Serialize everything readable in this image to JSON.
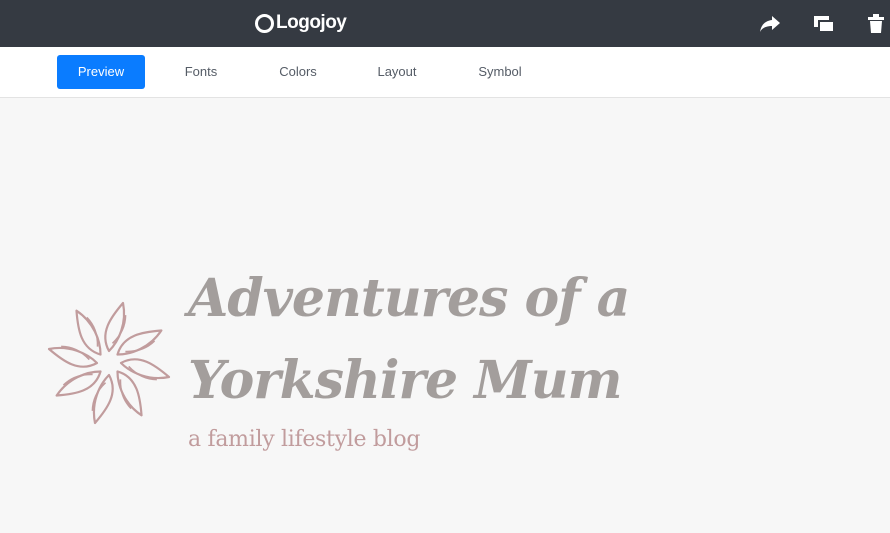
{
  "header": {
    "brand": "Logojoy",
    "icons": [
      "share-icon",
      "duplicate-icon",
      "trash-icon"
    ]
  },
  "tabs": [
    {
      "label": "Preview",
      "active": true
    },
    {
      "label": "Fonts",
      "active": false
    },
    {
      "label": "Colors",
      "active": false
    },
    {
      "label": "Layout",
      "active": false
    },
    {
      "label": "Symbol",
      "active": false
    }
  ],
  "logo": {
    "line1": "Adventures of a",
    "line2": "Yorkshire Mum",
    "tagline": "a family lifestyle blog",
    "symbol": "star-flower-icon",
    "text_color": "#a39e9c",
    "symbol_color": "#c19c9d"
  },
  "colors": {
    "topbar": "#353a42",
    "accent": "#0a7cff"
  }
}
